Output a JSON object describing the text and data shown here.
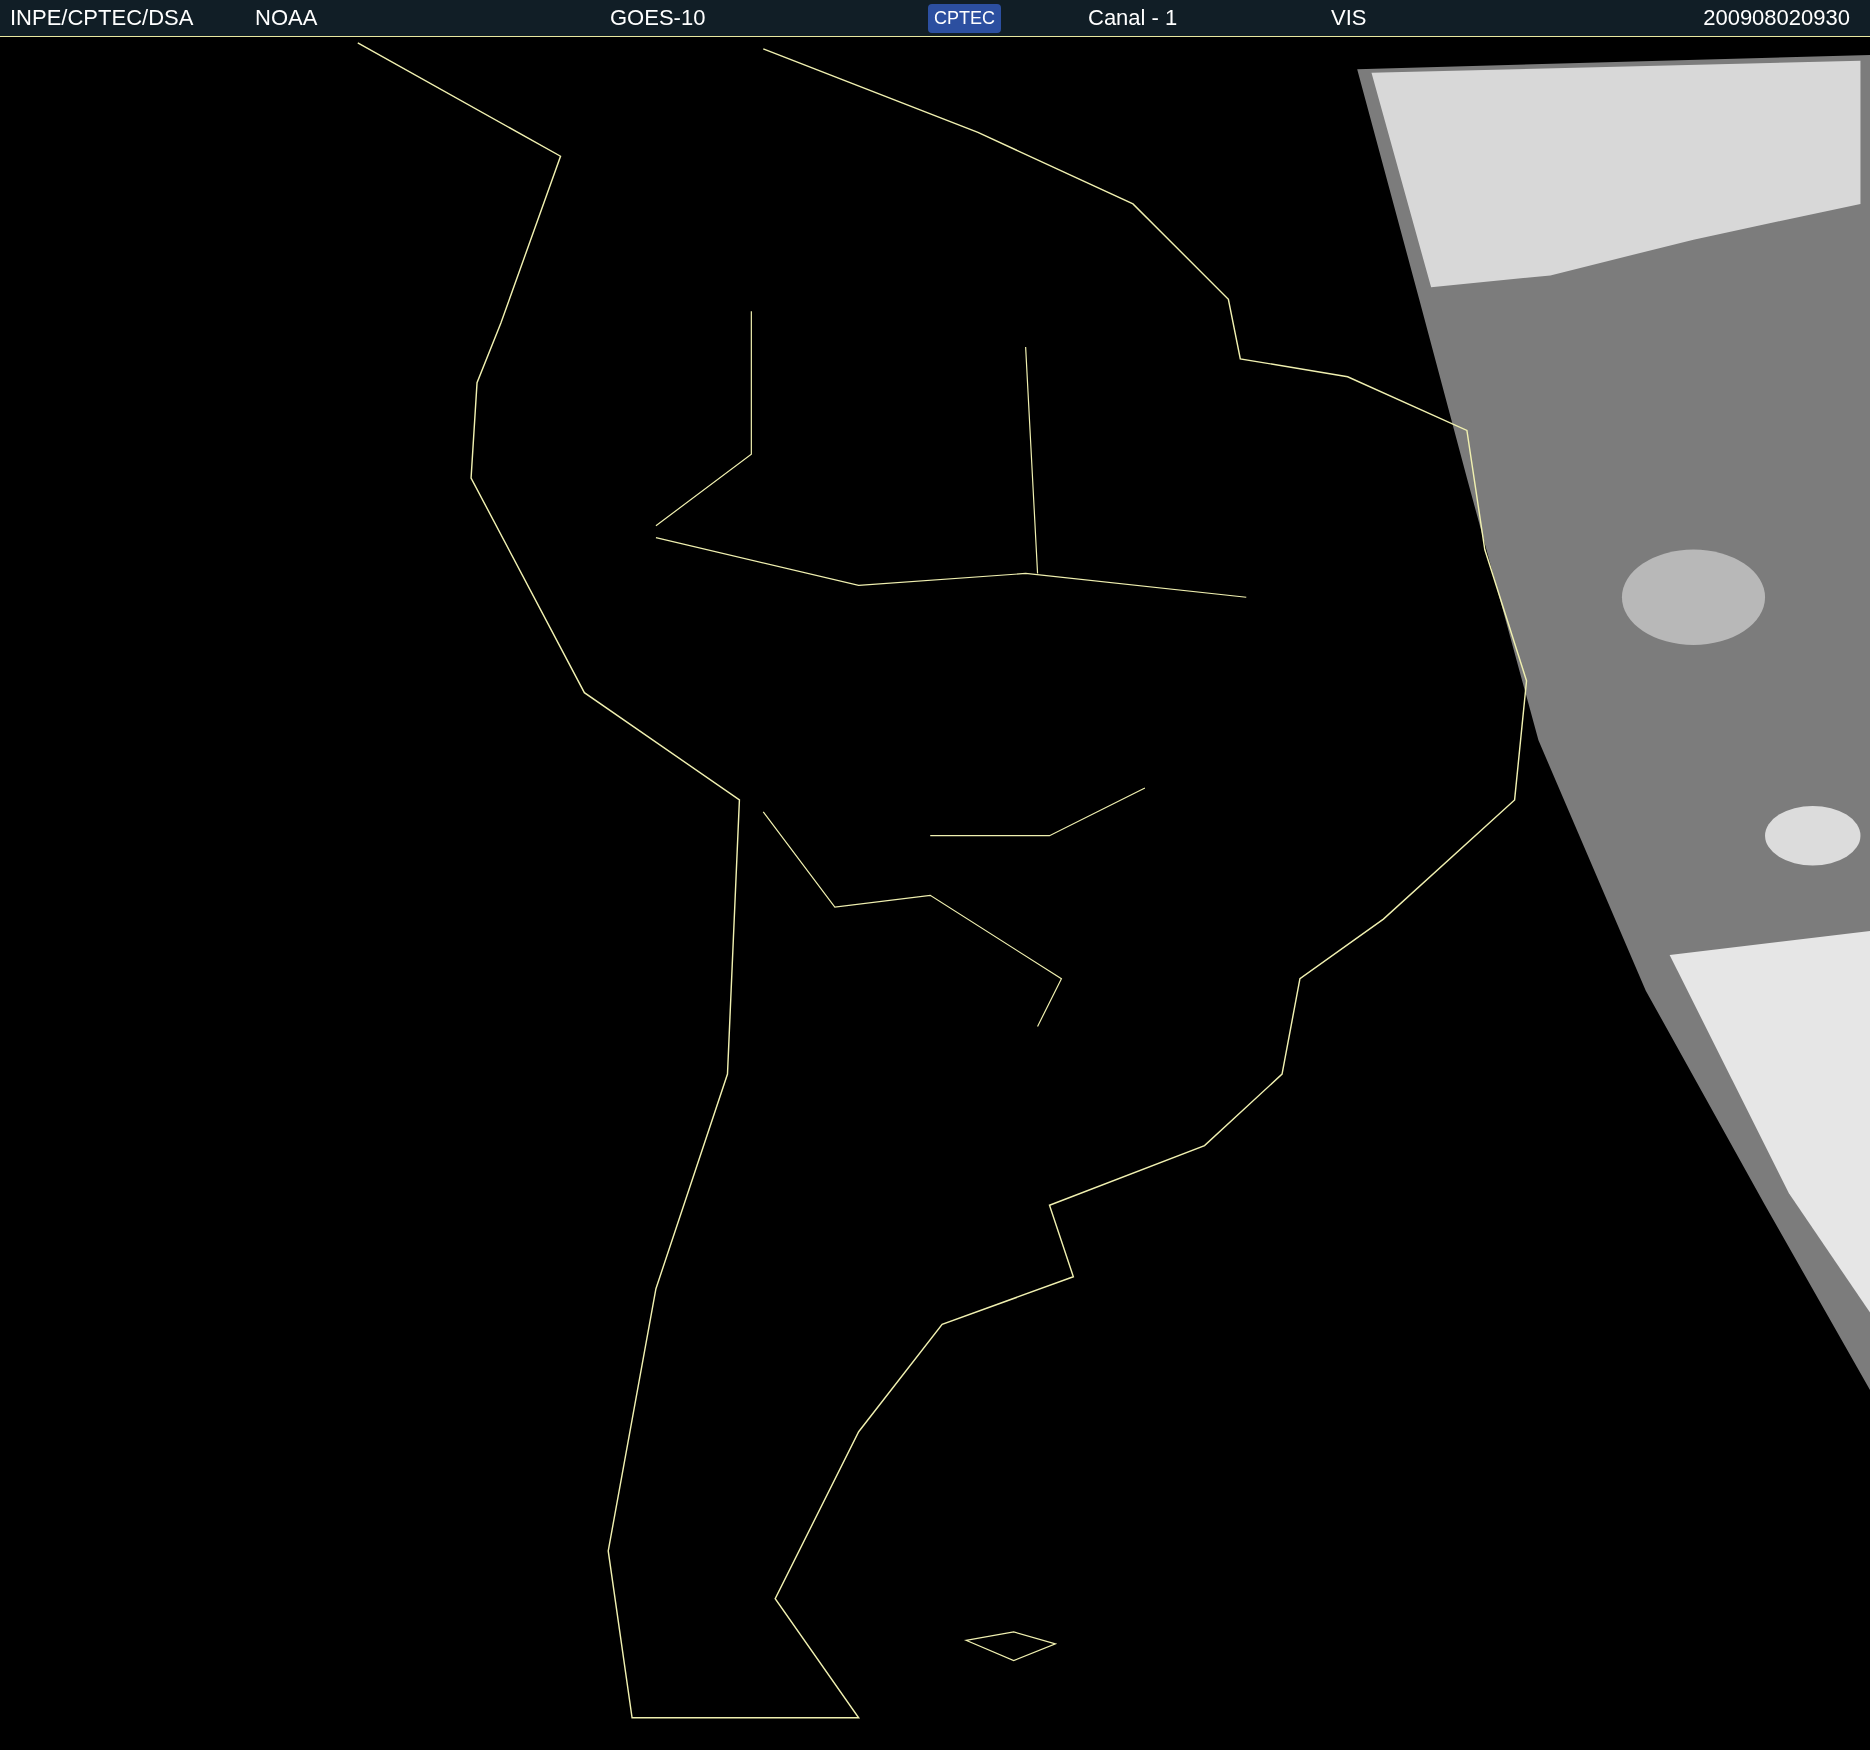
{
  "header": {
    "items": [
      {
        "kind": "text",
        "text": "INPE/CPTEC/DSA"
      },
      {
        "kind": "text",
        "text": "NOAA"
      },
      {
        "kind": "text",
        "text": "GOES-10"
      },
      {
        "kind": "logo",
        "text": "CPTEC"
      },
      {
        "kind": "text",
        "text": "Canal - 1"
      },
      {
        "kind": "text",
        "text": "VIS"
      },
      {
        "kind": "text",
        "text": "200908020930"
      }
    ]
  }
}
